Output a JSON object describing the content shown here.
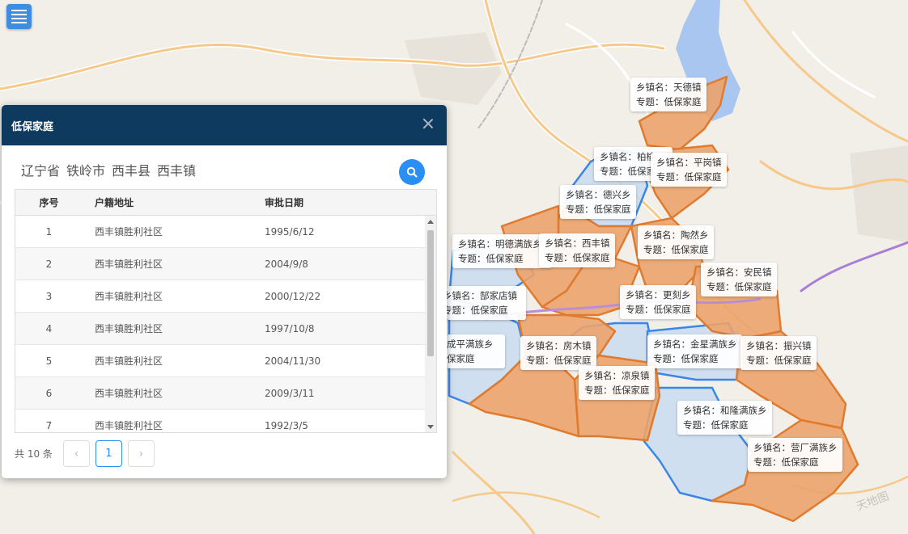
{
  "panel": {
    "title": "低保家庭",
    "region": [
      "辽宁省",
      "铁岭市",
      "西丰县",
      "西丰镇"
    ],
    "columns": [
      "序号",
      "户籍地址",
      "审批日期"
    ],
    "rows": [
      {
        "no": "1",
        "address": "西丰镇胜利社区",
        "date": "1995/6/12"
      },
      {
        "no": "2",
        "address": "西丰镇胜利社区",
        "date": "2004/9/8"
      },
      {
        "no": "3",
        "address": "西丰镇胜利社区",
        "date": "2000/12/22"
      },
      {
        "no": "4",
        "address": "西丰镇胜利社区",
        "date": "1997/10/8"
      },
      {
        "no": "5",
        "address": "西丰镇胜利社区",
        "date": "2004/11/30"
      },
      {
        "no": "6",
        "address": "西丰镇胜利社区",
        "date": "2009/3/11"
      },
      {
        "no": "7",
        "address": "西丰镇胜利社区",
        "date": "1992/3/5"
      }
    ],
    "total": "共 10 条",
    "prev": "‹",
    "page": "1",
    "next": "›"
  },
  "map_labels": [
    {
      "town": "乡镇名：天德镇",
      "topic": "专题：低保家庭"
    },
    {
      "town": "乡镇名：柏榆",
      "topic": "专题：低保家"
    },
    {
      "town": "乡镇名：平岗镇",
      "topic": "专题：低保家庭"
    },
    {
      "town": "乡镇名：德兴乡",
      "topic": "专题：低保家庭"
    },
    {
      "town": "乡镇名：明德满族乡",
      "topic": "专题：低保家庭"
    },
    {
      "town": "乡镇名：西丰镇",
      "topic": "专题：低保家庭"
    },
    {
      "town": "乡镇名：陶然乡",
      "topic": "专题：低保家庭"
    },
    {
      "town": "乡镇名：安民镇",
      "topic": "专题：低保家庭"
    },
    {
      "town": "乡镇名：郜家店镇",
      "topic": "专题：低保家庭"
    },
    {
      "town": "乡镇名：更刻乡",
      "topic": "专题：低保家庭"
    },
    {
      "town": "成平满族乡",
      "topic": "保家庭"
    },
    {
      "town": "乡镇名：房木镇",
      "topic": "专题：低保家庭"
    },
    {
      "town": "乡镇名：金星满族乡",
      "topic": "专题：低保家庭"
    },
    {
      "town": "乡镇名：振兴镇",
      "topic": "专题：低保家庭"
    },
    {
      "town": "乡镇名：凉泉镇",
      "topic": "专题：低保家庭"
    },
    {
      "town": "乡镇名：和隆满族乡",
      "topic": "专题：低保家庭"
    },
    {
      "town": "乡镇名：营厂满族乡",
      "topic": "专题：低保家庭"
    }
  ],
  "colors": {
    "header": "#0d3a5e",
    "accent": "#2b8ef3",
    "fill_orange": "#eba36b",
    "fill_blue": "#c9dcf0",
    "border_orange": "#e07b2e",
    "border_blue": "#3a86e6"
  },
  "icons": {
    "menu": "menu-icon",
    "close": "close-icon",
    "search": "search-icon"
  }
}
